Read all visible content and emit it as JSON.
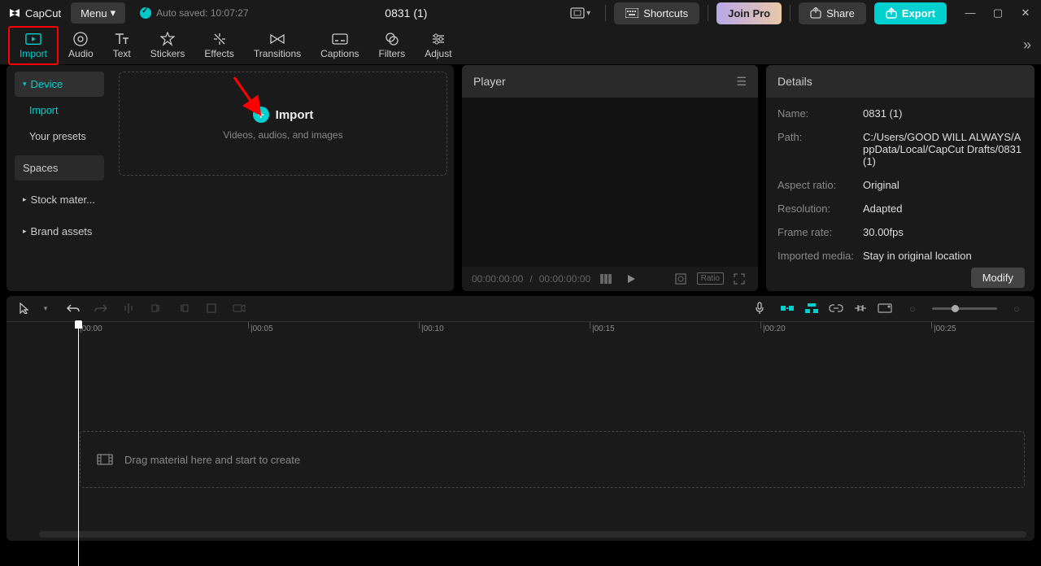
{
  "app": {
    "name": "CapCut",
    "menu_label": "Menu",
    "autosave": "Auto saved: 10:07:27",
    "project_title": "0831 (1)"
  },
  "titlebar": {
    "shortcuts": "Shortcuts",
    "join_pro": "Join Pro",
    "share": "Share",
    "export": "Export"
  },
  "tabs": {
    "import": "Import",
    "audio": "Audio",
    "text": "Text",
    "stickers": "Stickers",
    "effects": "Effects",
    "transitions": "Transitions",
    "captions": "Captions",
    "filters": "Filters",
    "adjust": "Adjust"
  },
  "sidebar": {
    "device": "Device",
    "import": "Import",
    "presets": "Your presets",
    "spaces": "Spaces",
    "stock": "Stock mater...",
    "brand": "Brand assets"
  },
  "import_area": {
    "title": "Import",
    "subtitle": "Videos, audios, and images"
  },
  "player": {
    "title": "Player",
    "time_current": "00:00:00:00",
    "time_sep": "/",
    "time_total": "00:00:00:00",
    "ratio": "Ratio"
  },
  "details": {
    "title": "Details",
    "name_l": "Name:",
    "name_v": "0831 (1)",
    "path_l": "Path:",
    "path_v": "C:/Users/GOOD WILL ALWAYS/AppData/Local/CapCut Drafts/0831 (1)",
    "aspect_l": "Aspect ratio:",
    "aspect_v": "Original",
    "res_l": "Resolution:",
    "res_v": "Adapted",
    "fps_l": "Frame rate:",
    "fps_v": "30.00fps",
    "media_l": "Imported media:",
    "media_v": "Stay in original location",
    "modify": "Modify"
  },
  "ruler": {
    "t0": "00:00",
    "t1": "00:05",
    "t2": "00:10",
    "t3": "00:15",
    "t4": "00:20",
    "t5": "00:25"
  },
  "timeline": {
    "drop_hint": "Drag material here and start to create"
  }
}
